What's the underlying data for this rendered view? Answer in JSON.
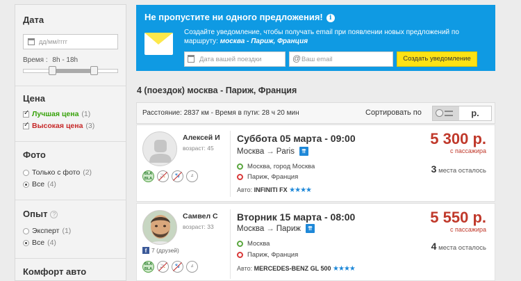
{
  "sidebar": {
    "date": {
      "title": "Дата",
      "placeholder": "дд/мм/гггг",
      "time_label": "Время :",
      "time_range": "8h - 18h"
    },
    "price": {
      "title": "Цена",
      "options": [
        {
          "label": "Лучшая цена",
          "count": "(1)",
          "checked": true
        },
        {
          "label": "Высокая цена",
          "count": "(3)",
          "checked": true
        }
      ]
    },
    "photo": {
      "title": "Фото",
      "options": [
        {
          "label": "Только с фото",
          "count": "(2)",
          "selected": false
        },
        {
          "label": "Все",
          "count": "(4)",
          "selected": true
        }
      ]
    },
    "experience": {
      "title": "Опыт",
      "help": "?",
      "options": [
        {
          "label": "Эксперт",
          "count": "(1)",
          "selected": false
        },
        {
          "label": "Все",
          "count": "(4)",
          "selected": true
        }
      ]
    },
    "comfort": {
      "title": "Комфорт авто"
    }
  },
  "alert": {
    "title": "Не пропустите ни одного предложения!",
    "info": "i",
    "text": "Создайте уведомление, чтобы получать email при появлении новых предложений по маршруту:",
    "route": "москва - Париж, Франция",
    "trip_date_placeholder": "Дата вашей поездки",
    "email_placeholder": "Ваш email",
    "button": "Создать уведомление",
    "colors": {
      "background": "#0f9ae3",
      "button": "#fde215"
    }
  },
  "results": {
    "title": "4 (поездок) москва - Париж, Франция",
    "distance_info": "Расстояние: 2837 км - Время в пути: 28 ч 20 мин",
    "sort_label": "Сортировать по",
    "sort_price": "р."
  },
  "trips": [
    {
      "driver": "Алексей И",
      "age": "возраст: 45",
      "date": "Суббота 05 марта - 09:00",
      "from": "Москва",
      "to": "Paris",
      "stop_from": "Москва, город Москва",
      "stop_to": "Париж, Франция",
      "car_label": "Авто:",
      "car": "INFINITI FX",
      "stars": "★★★★",
      "price": "5 300 р.",
      "per": "с пассажира",
      "seats_num": "3",
      "seats_text": "места осталось"
    },
    {
      "driver": "Самвел С",
      "age": "возраст: 33",
      "friends": "7 (друзей)",
      "date": "Вторник 15 марта - 08:00",
      "from": "Москва",
      "to": "Париж",
      "stop_from": "Москва",
      "stop_to": "Париж, Франция",
      "car_label": "Авто:",
      "car": "MERCEDES-BENZ GL 500",
      "stars": "★★★★",
      "price": "5 550 р.",
      "per": "с пассажира",
      "seats_num": "4",
      "seats_text": "места осталось"
    }
  ],
  "icons": {
    "highway": "highway-icon",
    "bla": "BLA BLA",
    "music": "♫"
  }
}
